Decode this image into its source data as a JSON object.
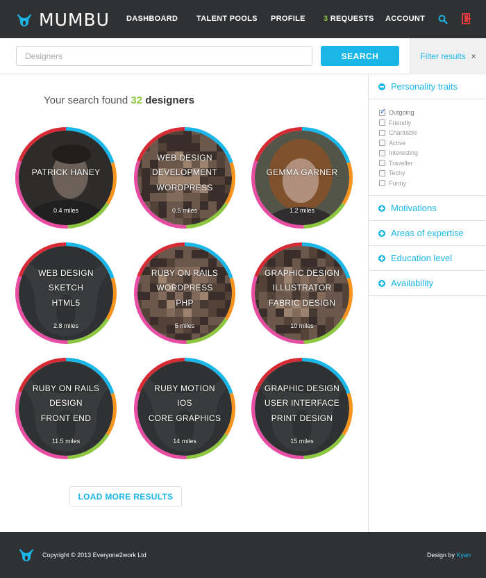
{
  "brand": {
    "name": "MUMBU"
  },
  "nav": {
    "dashboard": "DASHBOARD",
    "talent_pools": "TALENT POOLS",
    "profile": "PROFILE",
    "requests_count": "3",
    "requests_label": "REQUESTS",
    "account": "ACCOUNT",
    "search_icon": "search-icon",
    "logout_icon": "logout-icon"
  },
  "search": {
    "placeholder": "Designers",
    "button": "SEARCH",
    "filter_label": "Filter results",
    "filter_close": "×"
  },
  "results": {
    "prefix": "Your search found",
    "count": "32",
    "noun": "designers"
  },
  "cards": [
    {
      "lines": [
        "PATRICK HANEY"
      ],
      "distance": "0.4 miles",
      "style": "photo-man"
    },
    {
      "lines": [
        "WEB DESIGN",
        "DEVELOPMENT",
        "WORDPRESS"
      ],
      "distance": "0.5 miles",
      "style": "pixel"
    },
    {
      "lines": [
        "GEMMA GARNER"
      ],
      "distance": "1.2 miles",
      "style": "photo-woman"
    },
    {
      "lines": [
        "WEB DESIGN",
        "SKETCH",
        "HTML5"
      ],
      "distance": "2.8 miles",
      "style": "logo"
    },
    {
      "lines": [
        "RUBY ON RAILS",
        "WORDPRESS",
        "PHP"
      ],
      "distance": "5 miles",
      "style": "pixel"
    },
    {
      "lines": [
        "GRAPHIC DESIGN",
        "ILLUSTRATOR",
        "FABRIC DESIGN"
      ],
      "distance": "10 miles",
      "style": "pixel"
    },
    {
      "lines": [
        "RUBY ON RAILS",
        "DESIGN",
        "FRONT END"
      ],
      "distance": "11.5 miles",
      "style": "logo"
    },
    {
      "lines": [
        "RUBY MOTION",
        "IOS",
        "CORE GRAPHICS"
      ],
      "distance": "14 miles",
      "style": "logo"
    },
    {
      "lines": [
        "GRAPHIC DESIGN",
        "USER INTERFACE",
        "PRINT DESIGN"
      ],
      "distance": "15 miles",
      "style": "logo"
    }
  ],
  "load_more": "LOAD MORE RESULTS",
  "filters": {
    "personality": {
      "title": "Personality traits",
      "options": [
        {
          "label": "Outgoing",
          "checked": true
        },
        {
          "label": "Friendly",
          "checked": false
        },
        {
          "label": "Charitable",
          "checked": false
        },
        {
          "label": "Active",
          "checked": false
        },
        {
          "label": "Interesting",
          "checked": false
        },
        {
          "label": "Traveller",
          "checked": false
        },
        {
          "label": "Techy",
          "checked": false
        },
        {
          "label": "Funny",
          "checked": false
        }
      ]
    },
    "motivations": "Motivations",
    "expertise": "Areas of expertise",
    "education": "Education level",
    "availability": "Availability"
  },
  "footer": {
    "copyright": "Copyright © 2013 Everyone2work Ltd",
    "design_by": "Design by",
    "designer": "Kyan"
  },
  "colors": {
    "accent": "#1ab6e8",
    "green": "#8dc63f",
    "ring": [
      "#d62b34",
      "#1ab6e8",
      "#f7941d",
      "#8dc63f",
      "#e64da3"
    ],
    "dark": "#2f3133"
  }
}
